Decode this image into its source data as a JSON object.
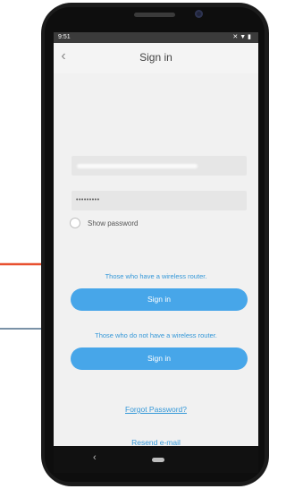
{
  "status_bar": {
    "time": "9:51",
    "icons": [
      "mute-icon",
      "wifi-icon",
      "battery-icon"
    ]
  },
  "header": {
    "title": "Sign in",
    "back_icon": "chevron-left-icon"
  },
  "form": {
    "username": {
      "value": ""
    },
    "password": {
      "value": "•••••••••"
    },
    "show_password_label": "Show password"
  },
  "sections": [
    {
      "label": "Those who have a wireless router.",
      "button_label": "Sign in"
    },
    {
      "label": "Those who do not have a wireless router.",
      "button_label": "Sign in"
    }
  ],
  "links": {
    "forgot_password": "Forgot Password?",
    "resend_email": "Resend e-mail"
  },
  "nav_bar": {
    "back_icon": "triangle-back-icon",
    "home_icon": "home-pill-icon"
  },
  "colors": {
    "accent": "#47a6e9",
    "link": "#3598d8",
    "red_arrow": "#e8502f",
    "blue_arrow": "#4f6f8a"
  }
}
